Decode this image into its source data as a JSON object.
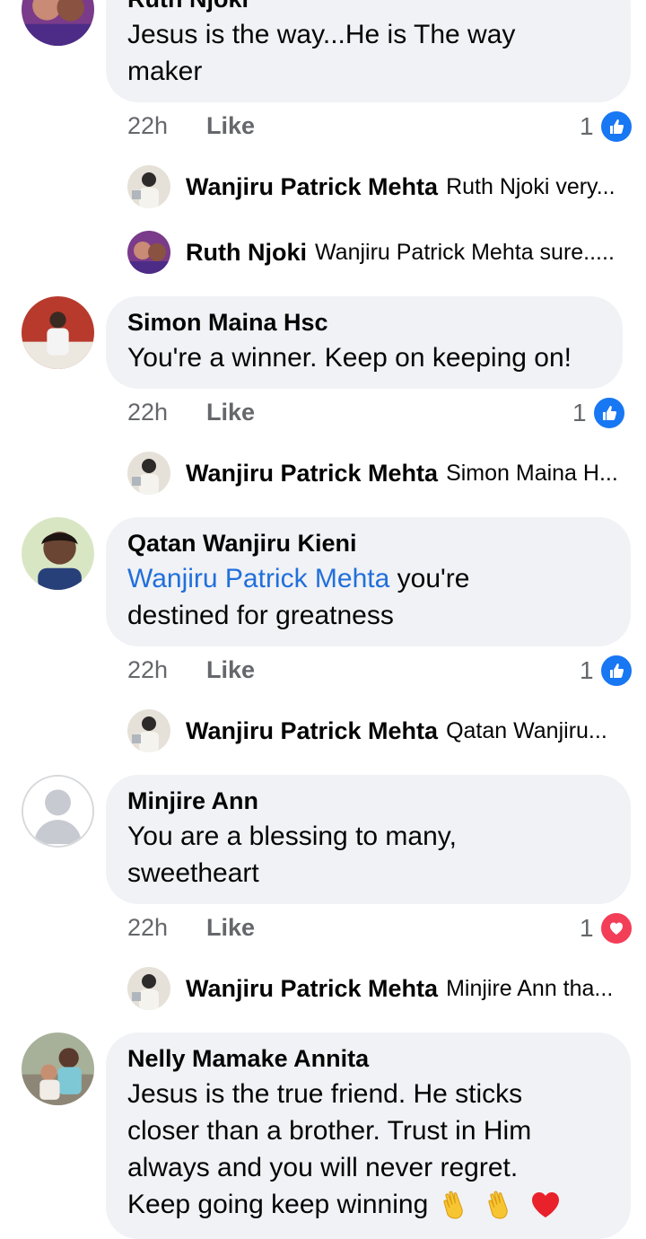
{
  "comments": [
    {
      "author": "Ruth Njoki",
      "lines": [
        "Jesus is the way...He is The way",
        "maker"
      ],
      "time": "22h",
      "like_label": "Like",
      "reaction_count": "1",
      "reaction_icon": "like-icon",
      "replies": [
        {
          "author": "Wanjiru Patrick Mehta",
          "preview": "Ruth Njoki very..."
        },
        {
          "author": "Ruth Njoki",
          "preview": "Wanjiru Patrick Mehta sure....."
        }
      ]
    },
    {
      "author": "Simon Maina Hsc",
      "lines": [
        "You're a winner. Keep on keeping on!"
      ],
      "time": "22h",
      "like_label": "Like",
      "reaction_count": "1",
      "reaction_icon": "like-icon",
      "replies": [
        {
          "author": "Wanjiru Patrick Mehta",
          "preview": "Simon Maina H..."
        }
      ]
    },
    {
      "author": "Qatan Wanjiru Kieni",
      "mention": "Wanjiru Patrick Mehta",
      "lines": [
        " you're",
        "destined for greatness"
      ],
      "time": "22h",
      "like_label": "Like",
      "reaction_count": "1",
      "reaction_icon": "like-icon",
      "replies": [
        {
          "author": "Wanjiru Patrick Mehta",
          "preview": "Qatan Wanjiru..."
        }
      ]
    },
    {
      "author": "Minjire Ann",
      "lines": [
        "You are a blessing to many,",
        "sweetheart"
      ],
      "time": "22h",
      "like_label": "Like",
      "reaction_count": "1",
      "reaction_icon": "love-icon",
      "replies": [
        {
          "author": "Wanjiru Patrick Mehta",
          "preview": "Minjire Ann tha..."
        }
      ]
    },
    {
      "author": "Nelly Mamake Annita",
      "lines": [
        "Jesus is the true friend. He sticks",
        "closer than a brother. Trust in Him",
        "always and you will never regret.",
        "Keep going keep winning"
      ],
      "emoji": [
        "clapping-hands-icon",
        "clapping-hands-icon",
        "red-heart-icon"
      ]
    }
  ],
  "colors": {
    "bubble": "#f0f2f5",
    "meta_text": "#65676b",
    "mention": "#216fdb",
    "like_blue": "#1877f2",
    "love_red": "#f33e58"
  }
}
